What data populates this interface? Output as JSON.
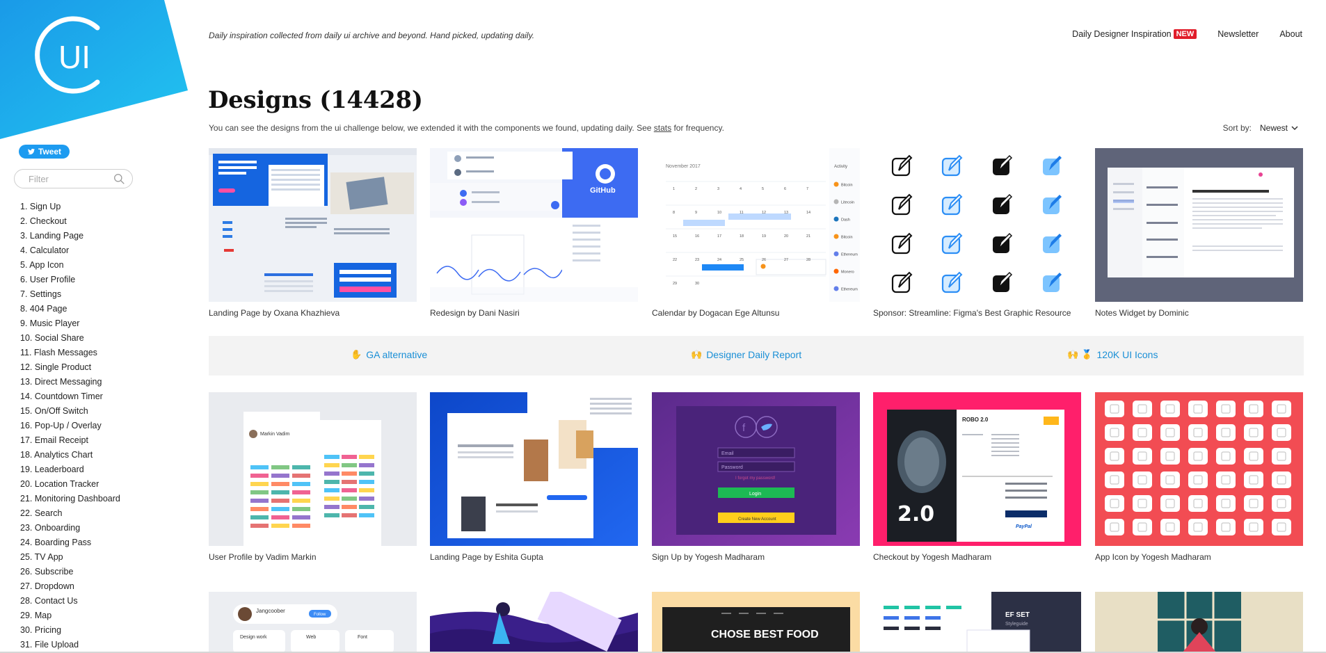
{
  "brand": {
    "logo_text": "UI",
    "accent": "#1fb0ec"
  },
  "sidebar": {
    "tweet_label": "Tweet",
    "filter_placeholder": "Filter",
    "challenges": [
      "1. Sign Up",
      "2. Checkout",
      "3. Landing Page",
      "4. Calculator",
      "5. App Icon",
      "6. User Profile",
      "7. Settings",
      "8. 404 Page",
      "9. Music Player",
      "10. Social Share",
      "11. Flash Messages",
      "12. Single Product",
      "13. Direct Messaging",
      "14. Countdown Timer",
      "15. On/Off Switch",
      "16. Pop-Up / Overlay",
      "17. Email Receipt",
      "18. Analytics Chart",
      "19. Leaderboard",
      "20. Location Tracker",
      "21. Monitoring Dashboard",
      "22. Search",
      "23. Onboarding",
      "24. Boarding Pass",
      "25. TV App",
      "26. Subscribe",
      "27. Dropdown",
      "28. Contact Us",
      "29. Map",
      "30. Pricing",
      "31. File Upload"
    ]
  },
  "header": {
    "tagline": "Daily inspiration collected from daily ui archive and beyond. Hand picked, updating daily.",
    "nav": {
      "daily_designer": "Daily Designer Inspiration",
      "new_badge": "NEW",
      "newsletter": "Newsletter",
      "about": "About"
    },
    "title": "Designs (14428)",
    "subtitle_before": "You can see the designs from the ui challenge below, we extended it with the components we found, updating daily. See ",
    "subtitle_link": "stats",
    "subtitle_after": " for frequency.",
    "sort_label": "Sort by:",
    "sort_value": "Newest"
  },
  "promos": {
    "ga": {
      "emoji": "✋",
      "label": "GA alternative"
    },
    "report": {
      "emoji": "🙌",
      "label": "Designer Daily Report"
    },
    "icons": {
      "emoji": "🙌 🥇",
      "label": "120K UI Icons"
    }
  },
  "row1": [
    {
      "caption": "Landing Page by Oxana Khazhieva"
    },
    {
      "caption": "Redesign by Dani Nasiri",
      "thumb_text": "GitHub"
    },
    {
      "caption": "Calendar by Dogacan Ege Altunsu",
      "thumb_month": "November 2017",
      "thumb_side": "Activity",
      "coins": [
        "Bitcoin",
        "Litecoin",
        "Dash",
        "Bitcoin",
        "Ethereum",
        "Monero",
        "Ethereum"
      ]
    },
    {
      "caption": "Sponsor: Streamline: Figma's Best Graphic Resource"
    },
    {
      "caption": "Notes Widget by Dominic"
    }
  ],
  "row2": [
    {
      "caption": "User Profile by Vadim Markin",
      "thumb_name": "Markin Vadim"
    },
    {
      "caption": "Landing Page by Eshita Gupta"
    },
    {
      "caption": "Sign Up by Yogesh Madharam",
      "email_ph": "Email",
      "password_ph": "Password",
      "forgot": "I forgot my password!",
      "login": "Login",
      "create": "Create New Account"
    },
    {
      "caption": "Checkout by Yogesh Madharam",
      "movie_title": "ROBO 2.0",
      "movie_big": "2.0",
      "paypal": "PayPal"
    },
    {
      "caption": "App Icon by Yogesh Madharam"
    }
  ],
  "row3": [
    {
      "user": "Jangcoober",
      "follow": "Follow",
      "chips": [
        "Design work",
        "Web",
        "Font"
      ]
    },
    {
      "label": ""
    },
    {
      "headline": "CHOSE BEST FOOD"
    },
    {
      "title": "EF SET",
      "sub": "Styleguide"
    },
    {
      "label": ""
    }
  ]
}
